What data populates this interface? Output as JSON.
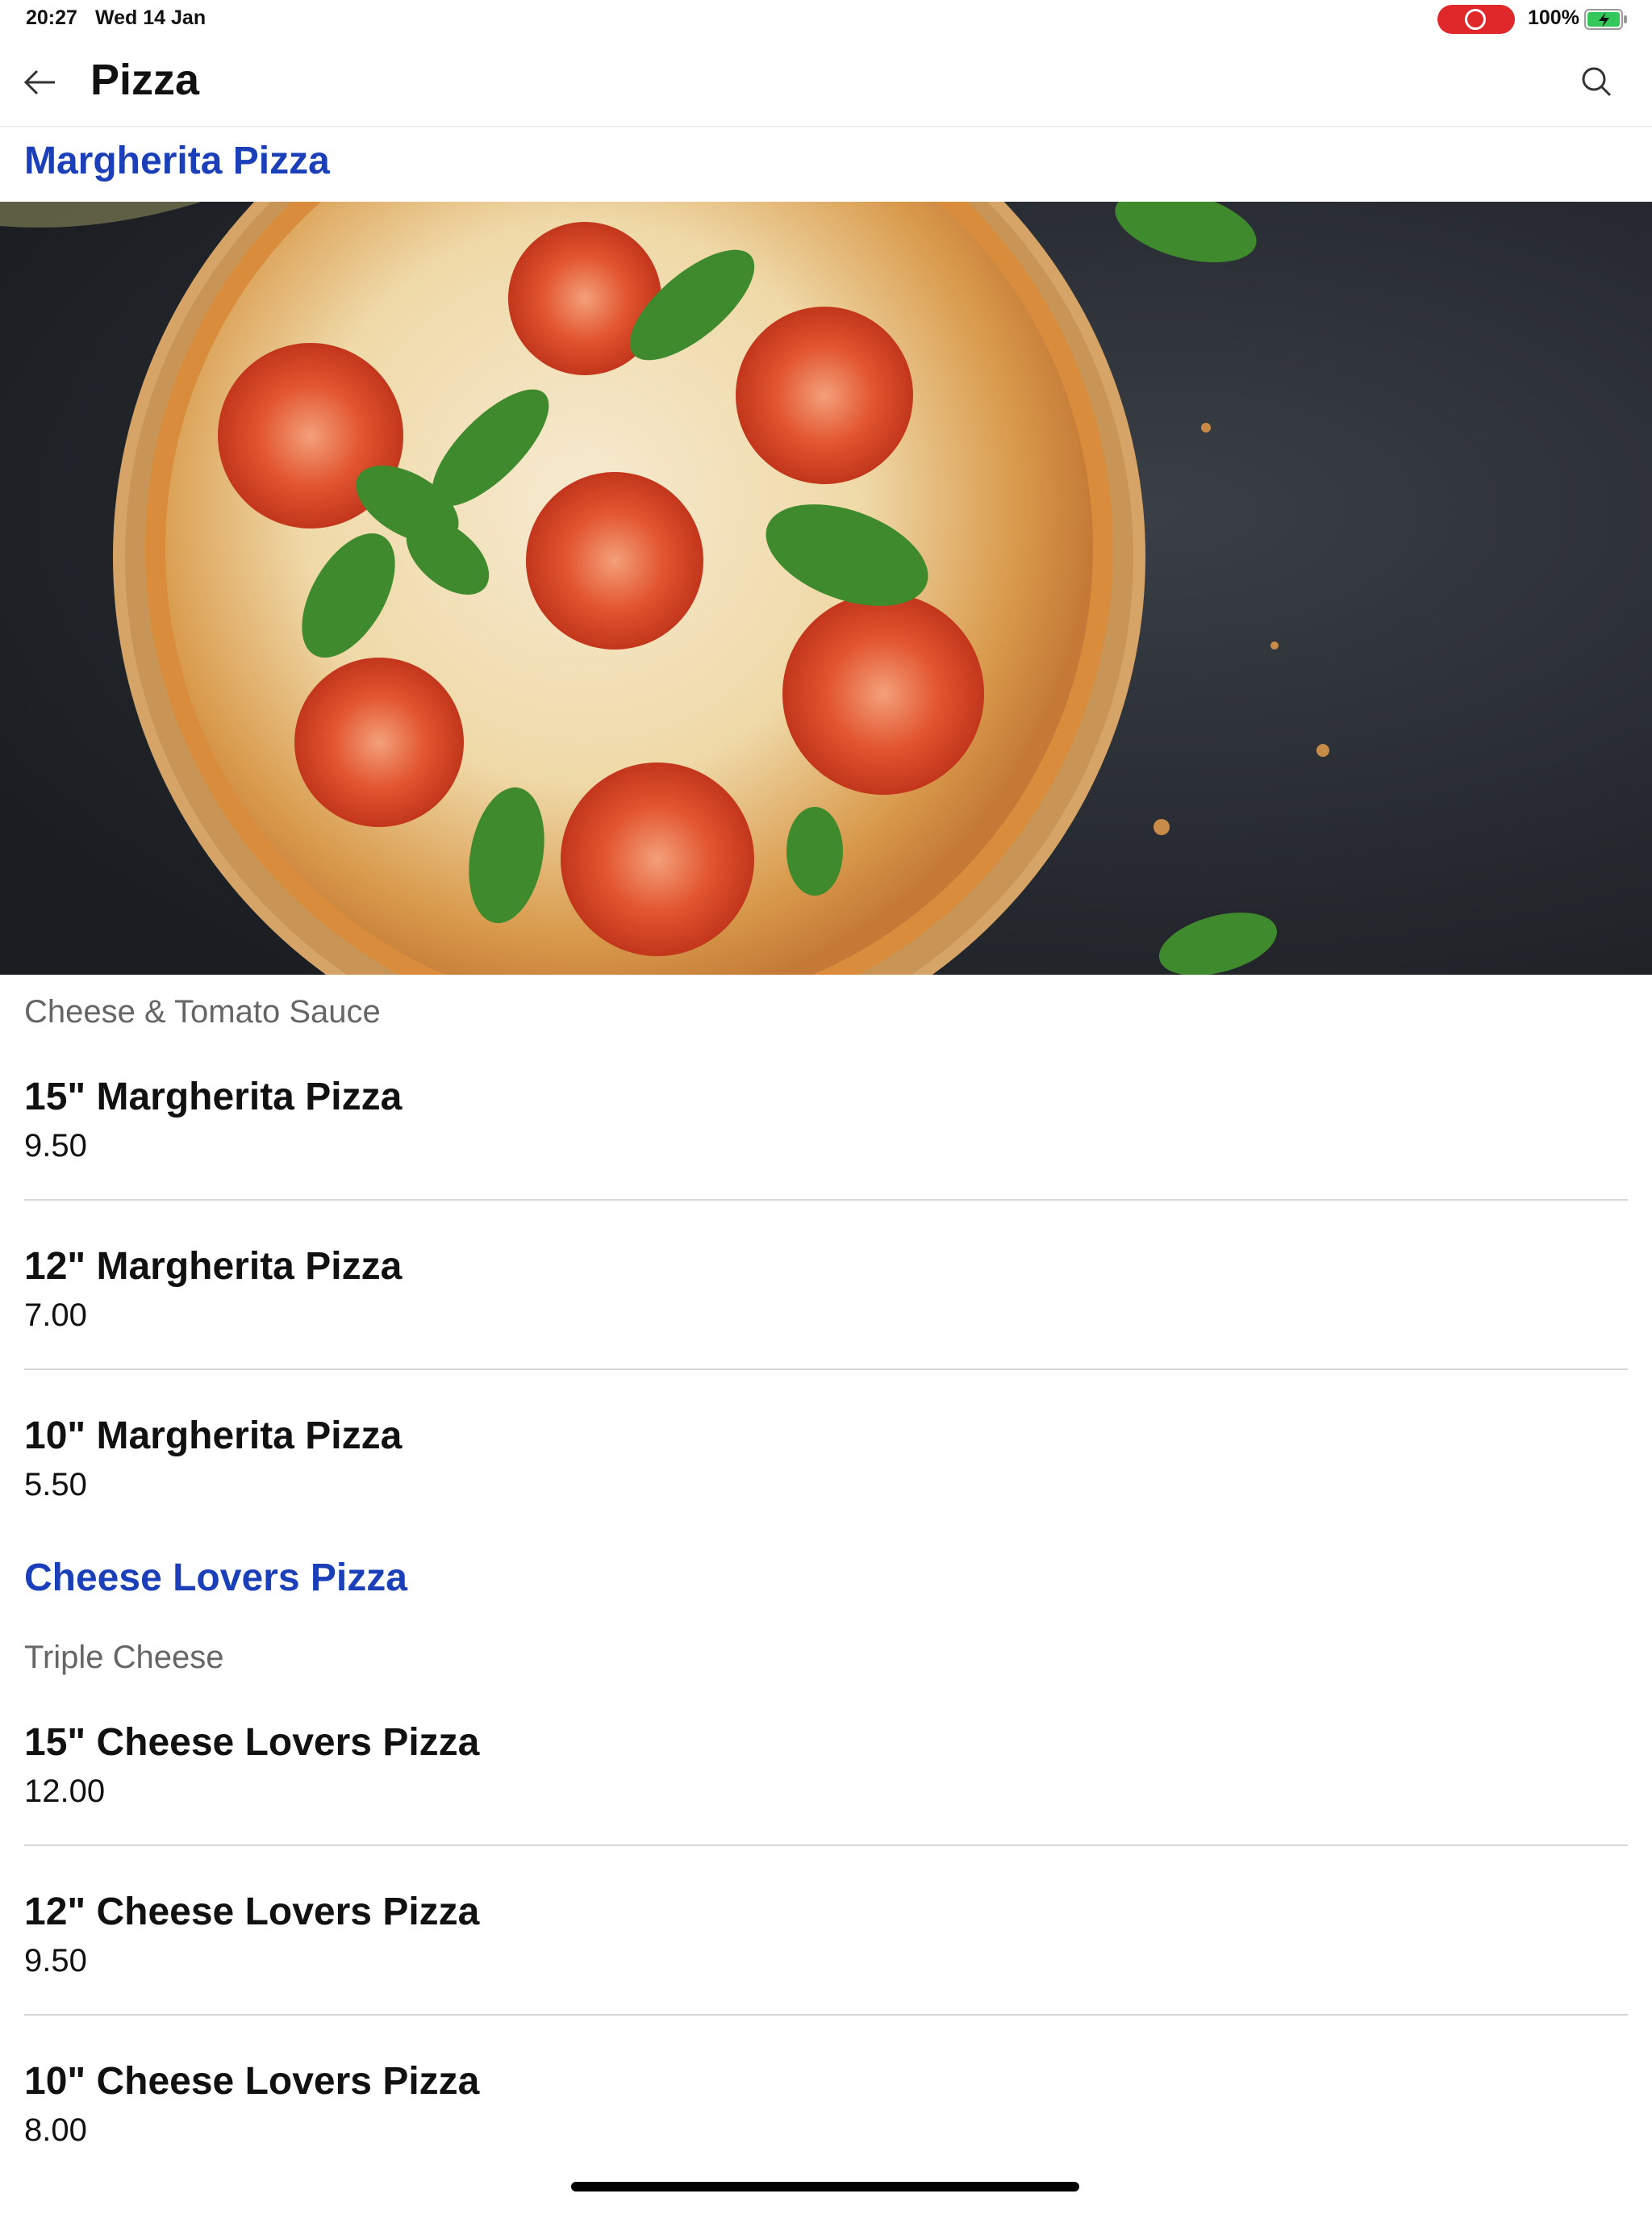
{
  "status_bar": {
    "time": "20:27",
    "date": "Wed 14 Jan",
    "battery": "100%"
  },
  "nav": {
    "title": "Pizza"
  },
  "sections": [
    {
      "title": "Margherita Pizza",
      "description": "Cheese & Tomato Sauce",
      "items": [
        {
          "name": "15\" Margherita Pizza",
          "price": "9.50"
        },
        {
          "name": "12\" Margherita Pizza",
          "price": "7.00"
        },
        {
          "name": "10\" Margherita Pizza",
          "price": "5.50"
        }
      ]
    },
    {
      "title": "Cheese Lovers Pizza",
      "description": "Triple Cheese",
      "items": [
        {
          "name": "15\" Cheese Lovers Pizza",
          "price": "12.00"
        },
        {
          "name": "12\" Cheese Lovers Pizza",
          "price": "9.50"
        },
        {
          "name": "10\" Cheese Lovers Pizza",
          "price": "8.00"
        }
      ]
    }
  ],
  "colors": {
    "section_title": "#1a3fb8",
    "description": "#666666",
    "record_pill": "#e0282b"
  }
}
